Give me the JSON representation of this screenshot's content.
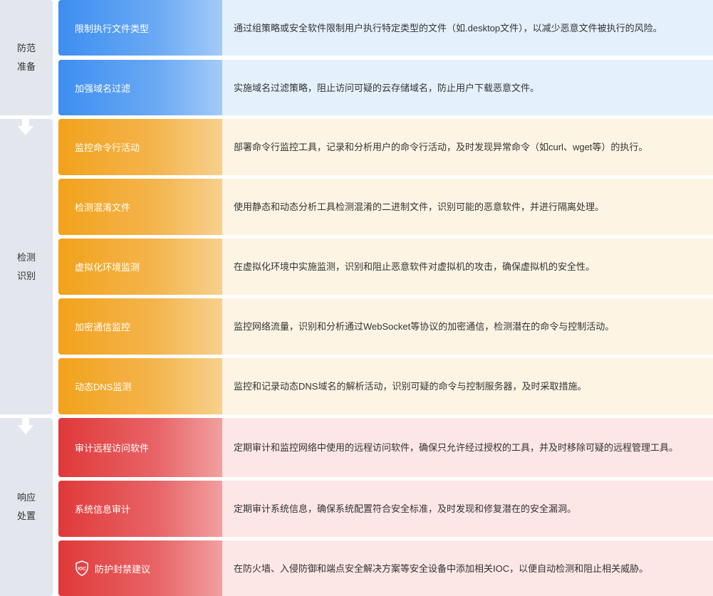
{
  "phases": [
    {
      "label": "防范准备"
    },
    {
      "label": "检测识别"
    },
    {
      "label": "响应处置"
    }
  ],
  "rows": [
    {
      "label": "限制执行文件类型",
      "desc": "通过组策略或安全软件限制用户执行特定类型的文件（如.desktop文件），以减少恶意文件被执行的风险。",
      "color": "#3d8ef0"
    },
    {
      "label": "加强域名过滤",
      "desc": "实施域名过滤策略，阻止访问可疑的云存储域名，防止用户下载恶意文件。",
      "color": "#3d8ef0"
    },
    {
      "label": "监控命令行活动",
      "desc": "部署命令行监控工具，记录和分析用户的命令行活动，及时发现异常命令（如curl、wget等）的执行。",
      "color": "#f2a21b"
    },
    {
      "label": "检测混淆文件",
      "desc": "使用静态和动态分析工具检测混淆的二进制文件，识别可能的恶意软件，并进行隔离处理。",
      "color": "#f2a21b"
    },
    {
      "label": "虚拟化环境监测",
      "desc": "在虚拟化环境中实施监测，识别和阻止恶意软件对虚拟机的攻击，确保虚拟机的安全性。",
      "color": "#f2a21b"
    },
    {
      "label": "加密通信监控",
      "desc": "监控网络流量，识别和分析通过WebSocket等协议的加密通信，检测潜在的命令与控制活动。",
      "color": "#f2a21b"
    },
    {
      "label": "动态DNS监测",
      "desc": "监控和记录动态DNS域名的解析活动，识别可疑的命令与控制服务器，及时采取措施。",
      "color": "#f2a21b"
    },
    {
      "label": "审计远程访问软件",
      "desc": "定期审计和监控网络中使用的远程访问软件，确保只允许经过授权的工具，并及时移除可疑的远程管理工具。",
      "color": "#e0393a"
    },
    {
      "label": "系统信息审计",
      "desc": "定期审计系统信息，确保系统配置符合安全标准，及时发现和修复潜在的安全漏洞。",
      "color": "#e0393a"
    },
    {
      "label": "防护封禁建议",
      "desc": "在防火墙、入侵防御和端点安全解决方案等安全设备中添加相关IOC，以便自动检测和阻止相关威胁。",
      "color": "#e0393a",
      "icon": "ioc-icon",
      "icon_text": "IOC"
    }
  ],
  "arrows": [
    {
      "icon": "arrow-down-icon"
    },
    {
      "icon": "arrow-down-icon"
    }
  ]
}
